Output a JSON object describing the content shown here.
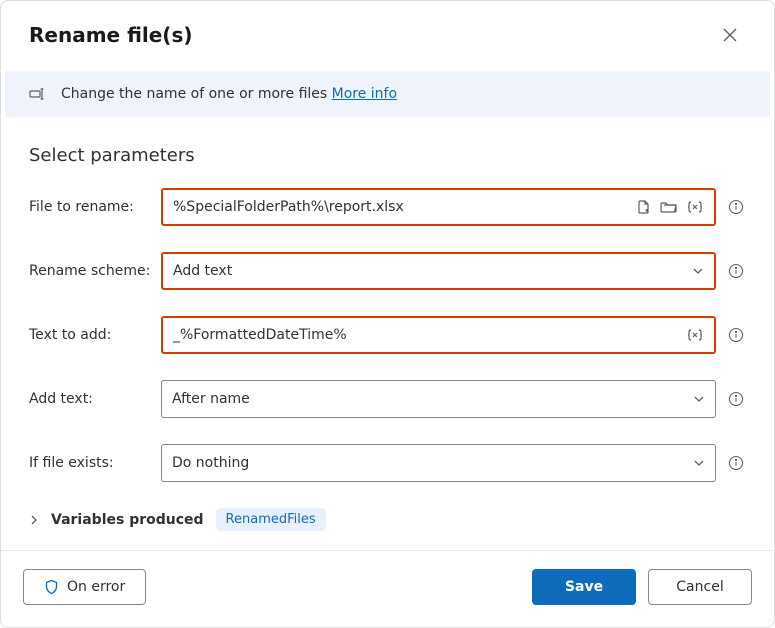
{
  "title": "Rename file(s)",
  "banner": {
    "text": "Change the name of one or more files ",
    "link": "More info"
  },
  "section": "Select parameters",
  "rows": {
    "file": {
      "label": "File to rename:",
      "value": "%SpecialFolderPath%\\report.xlsx"
    },
    "scheme": {
      "label": "Rename scheme:",
      "value": "Add text"
    },
    "textadd": {
      "label": "Text to add:",
      "value": "_%FormattedDateTime%"
    },
    "addtextpos": {
      "label": "Add text:",
      "value": "After name"
    },
    "exists": {
      "label": "If file exists:",
      "value": "Do nothing"
    }
  },
  "vars": {
    "label": "Variables produced",
    "chip": "RenamedFiles"
  },
  "footer": {
    "onerror": "On error",
    "save": "Save",
    "cancel": "Cancel"
  }
}
